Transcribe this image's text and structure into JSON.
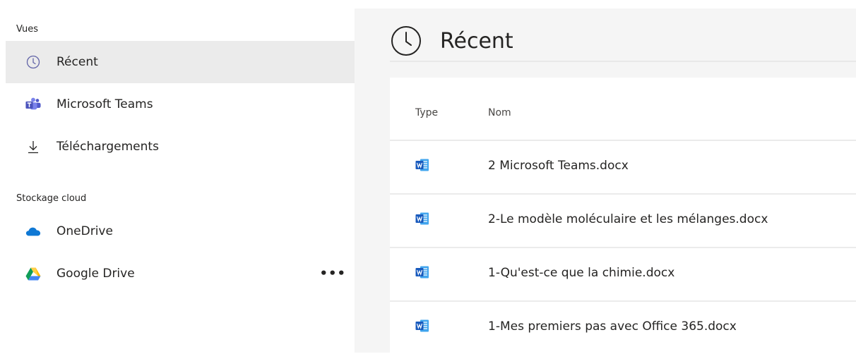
{
  "sidebar": {
    "views_label": "Vues",
    "views": [
      {
        "label": "Récent",
        "icon": "clock-icon",
        "active": true
      },
      {
        "label": "Microsoft Teams",
        "icon": "teams-icon",
        "active": false
      },
      {
        "label": "Téléchargements",
        "icon": "download-icon",
        "active": false
      }
    ],
    "cloud_label": "Stockage cloud",
    "cloud": [
      {
        "label": "OneDrive",
        "icon": "onedrive-icon"
      },
      {
        "label": "Google Drive",
        "icon": "google-drive-icon",
        "more": "•••"
      }
    ]
  },
  "main": {
    "title": "Récent",
    "title_icon": "clock-icon",
    "columns": {
      "type": "Type",
      "name": "Nom"
    },
    "files": [
      {
        "name": "2 Microsoft Teams.docx",
        "icon": "word-icon"
      },
      {
        "name": "2-Le modèle moléculaire et les mélanges.docx",
        "icon": "word-icon"
      },
      {
        "name": "1-Qu'est-ce que la chimie.docx",
        "icon": "word-icon"
      },
      {
        "name": "1-Mes premiers pas avec Office 365.docx",
        "icon": "word-icon"
      }
    ]
  },
  "colors": {
    "accent": "#6264a7",
    "active_bg": "#ebebeb",
    "word_blue": "#2b579a"
  }
}
